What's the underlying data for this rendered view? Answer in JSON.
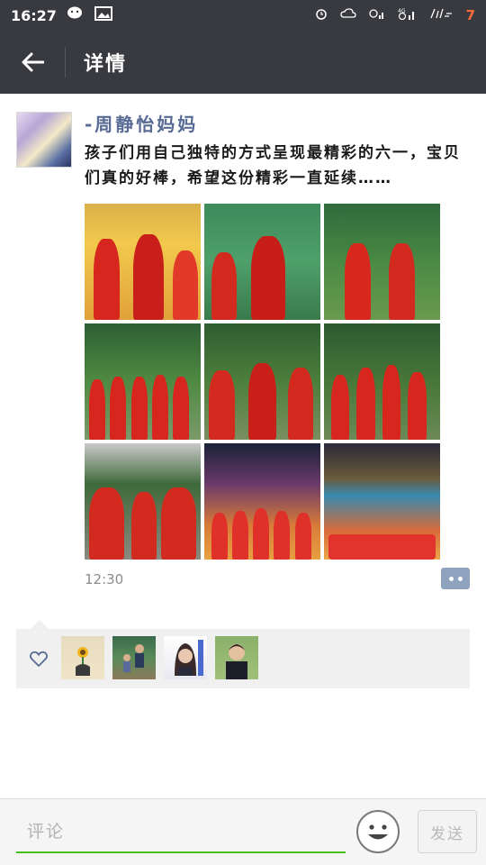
{
  "status_bar": {
    "time": "16:27",
    "battery_level": "7",
    "icons": [
      "wechat-icon",
      "image-icon",
      "alarm-icon",
      "cloud-icon",
      "signal-icon",
      "4g-signal-icon",
      "speed-icon"
    ]
  },
  "nav": {
    "title": "详情",
    "back_icon": "back-arrow-icon"
  },
  "post": {
    "username": "-周静怡妈妈",
    "text": "孩子们用自己独特的方式呈现最精彩的六一，宝贝们真的好棒，希望这份精彩一直延续……",
    "timestamp": "12:30",
    "photo_count": 9
  },
  "likes": {
    "icon": "heart-icon",
    "avatars": [
      "sunflower-avatar",
      "family-avatar",
      "woman-avatar",
      "boy-avatar"
    ]
  },
  "comment_bar": {
    "placeholder": "评论",
    "emoji_icon": "emoji-face-icon",
    "send_label": "发送"
  },
  "colors": {
    "bar_bg": "#393a3f",
    "link_blue": "#576b95",
    "input_green": "#45c01a"
  }
}
